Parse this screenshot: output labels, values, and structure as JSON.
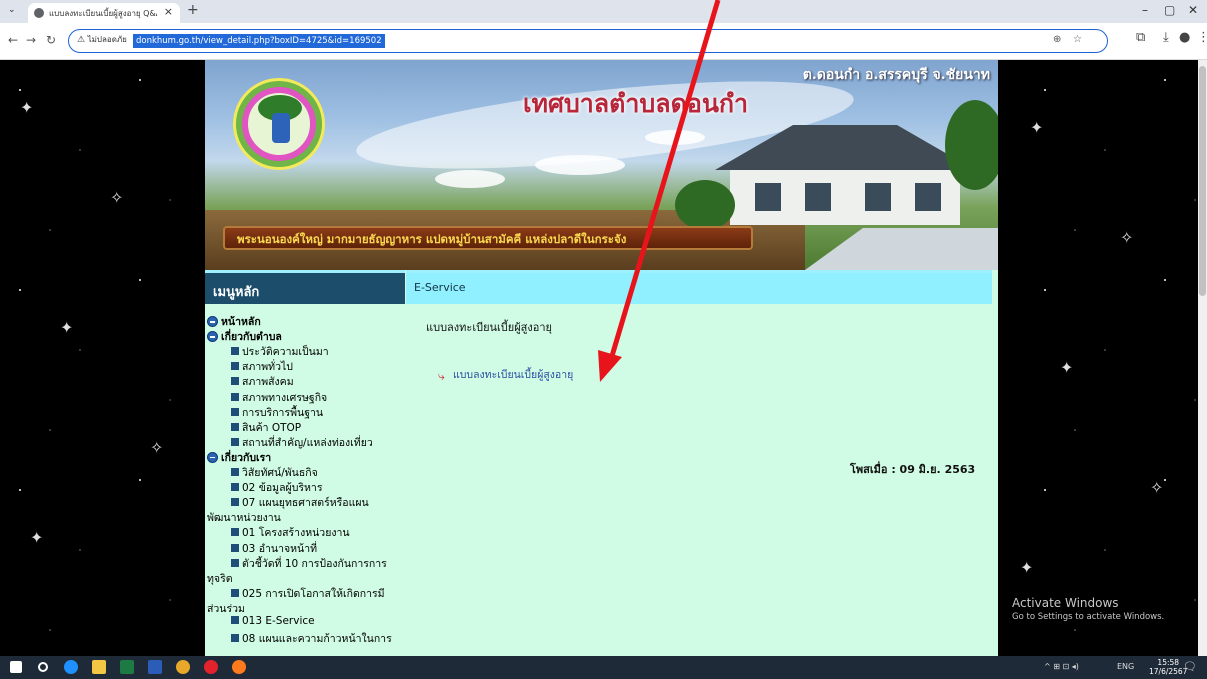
{
  "browser": {
    "tab_title": "แบบลงทะเบียนเบี้ยผู้สูงอายุ Q&A หน",
    "security_label": "ไม่ปลอดภัย",
    "url": "donkhum.go.th/view_detail.php?boxID=4725&id=169502"
  },
  "site": {
    "subtitle": "ต.ดอนกำ อ.สรรคบุรี จ.ชัยนาท",
    "title": "เทศบาลตำบลดอนกำ",
    "slogan": "พระนอนองค์ใหญ่ มากมายธัญญาหาร แปดหมู่บ้านสามัคคี แหล่งปลาดีในกระจัง"
  },
  "menu": {
    "header": "เมนูหลัก",
    "lines": [
      {
        "type": "sec",
        "text": "หน้าหลัก"
      },
      {
        "type": "sec",
        "text": "เกี่ยวกับตำบล"
      },
      {
        "type": "sub",
        "text": "ประวัติความเป็นมา"
      },
      {
        "type": "sub",
        "text": "สภาพทั่วไป"
      },
      {
        "type": "sub",
        "text": "สภาพสังคม"
      },
      {
        "type": "sub",
        "text": "สภาพทางเศรษฐกิจ"
      },
      {
        "type": "sub",
        "text": "การบริการพื้นฐาน"
      },
      {
        "type": "sub",
        "text": "สินค้า OTOP"
      },
      {
        "type": "sub",
        "text": "สถานที่สำคัญ/แหล่งท่องเที่ยว"
      },
      {
        "type": "sec",
        "text": "เกี่ยวกับเรา"
      },
      {
        "type": "sub",
        "text": "วิสัยทัศน์/พันธกิจ"
      },
      {
        "type": "sub",
        "text": "02 ข้อมูลผู้บริหาร"
      },
      {
        "type": "sub",
        "text": "07 แผนยุทธศาสตร์หรือแผน"
      },
      {
        "type": "cont",
        "text": "พัฒนาหน่วยงาน"
      },
      {
        "type": "sub",
        "text": "01 โครงสร้างหน่วยงาน"
      },
      {
        "type": "sub",
        "text": "03 อำนาจหน้าที่"
      },
      {
        "type": "sub",
        "text": "ตัวชี้วัดที่ 10 การป้องกันการการ"
      },
      {
        "type": "cont",
        "text": "ทุจริต"
      },
      {
        "type": "sub",
        "text": "025 การเปิดโอกาสให้เกิดการมี"
      },
      {
        "type": "cont",
        "text": "ส่วนร่วม"
      },
      {
        "type": "sub",
        "text": "013 E-Service"
      },
      {
        "type": "sub",
        "text": "08 แผนและความก้าวหน้าในการ"
      }
    ]
  },
  "content": {
    "header": "E-Service",
    "title": "แบบลงทะเบียนเบี้ยผู้สูงอายุ",
    "link": "แบบลงทะเบียนเบี้ยผู้สูงอายุ",
    "posted": "โพสเมื่อ : 09 มิ.ย. 2563"
  },
  "watermark": {
    "line1": "Activate Windows",
    "line2": "Go to Settings to activate Windows."
  },
  "taskbar": {
    "lang": "ENG",
    "time": "15:58",
    "date": "17/6/2567"
  },
  "colors": {
    "annotation_arrow": "#e8141b",
    "menu_header": "#1c4d6b",
    "content_header": "#90f0ff",
    "content_bg": "#d0fbe4"
  }
}
